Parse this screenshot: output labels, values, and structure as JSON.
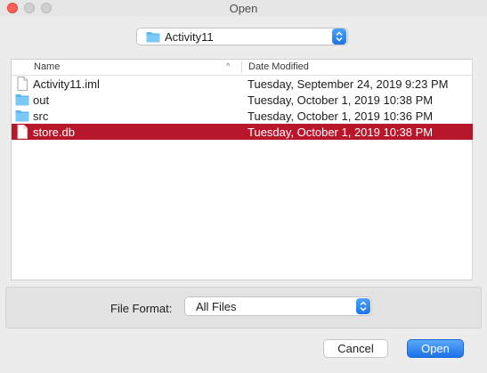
{
  "window": {
    "title": "Open"
  },
  "location": {
    "folder": "Activity11"
  },
  "columns": {
    "name": "Name",
    "date": "Date Modified"
  },
  "files": [
    {
      "name": "Activity11.iml",
      "date": "Tuesday, September 24, 2019 9:23 PM",
      "icon": "document-icon",
      "selected": false
    },
    {
      "name": "out",
      "date": "Tuesday, October 1, 2019 10:38 PM",
      "icon": "folder-icon",
      "selected": false
    },
    {
      "name": "src",
      "date": "Tuesday, October 1, 2019 10:36 PM",
      "icon": "folder-icon",
      "selected": false
    },
    {
      "name": "store.db",
      "date": "Tuesday, October 1, 2019 10:38 PM",
      "icon": "document-icon",
      "selected": true
    }
  ],
  "format": {
    "label": "File Format:",
    "value": "All Files"
  },
  "buttons": {
    "cancel": "Cancel",
    "open": "Open"
  },
  "colors": {
    "selection": "#b8162a",
    "accent": "#1d72e8",
    "folder": "#5ab7f1"
  }
}
